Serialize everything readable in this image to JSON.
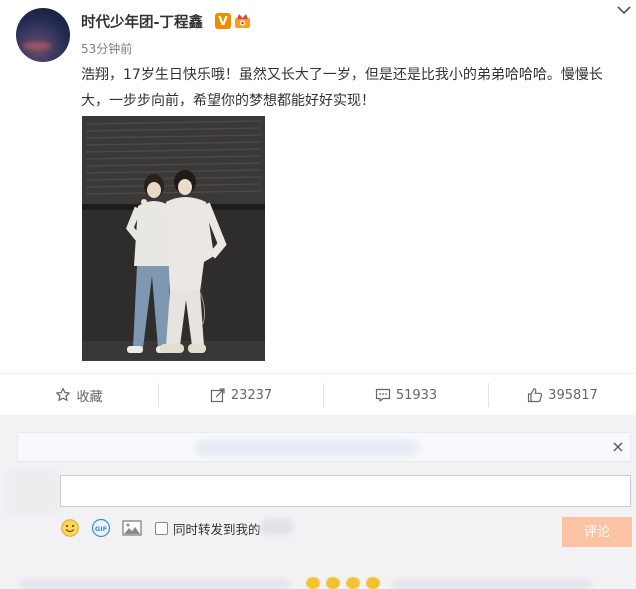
{
  "post": {
    "user_name": "时代少年团-丁程鑫",
    "verified_badge": "V",
    "time": "53分钟前",
    "text": "浩翔，17岁生日快乐哦！虽然又长大了一岁，但是还是比我小的弟弟哈哈哈。慢慢长大，一步步向前，希望你的梦想都能好好实现！"
  },
  "actions": {
    "favorite_label": "收藏",
    "repost_count": "23237",
    "comment_count": "51933",
    "like_count": "395817"
  },
  "comment_box": {
    "input_value": "",
    "repost_option_label": "同时转发到我的",
    "submit_label": "评论",
    "gif_label": "GIF"
  },
  "icons": {
    "more": "chevron-down-icon",
    "favorite": "star-icon",
    "repost": "share-icon",
    "comment": "comment-icon",
    "like": "thumbs-up-icon",
    "close": "close-icon",
    "emoji": "smiley-icon",
    "gif": "gif-icon",
    "image": "image-icon"
  },
  "colors": {
    "verified_badge": "#f08c00",
    "submit_button": "#fbc3a4",
    "comment_area_bg": "#f2f2f5"
  }
}
